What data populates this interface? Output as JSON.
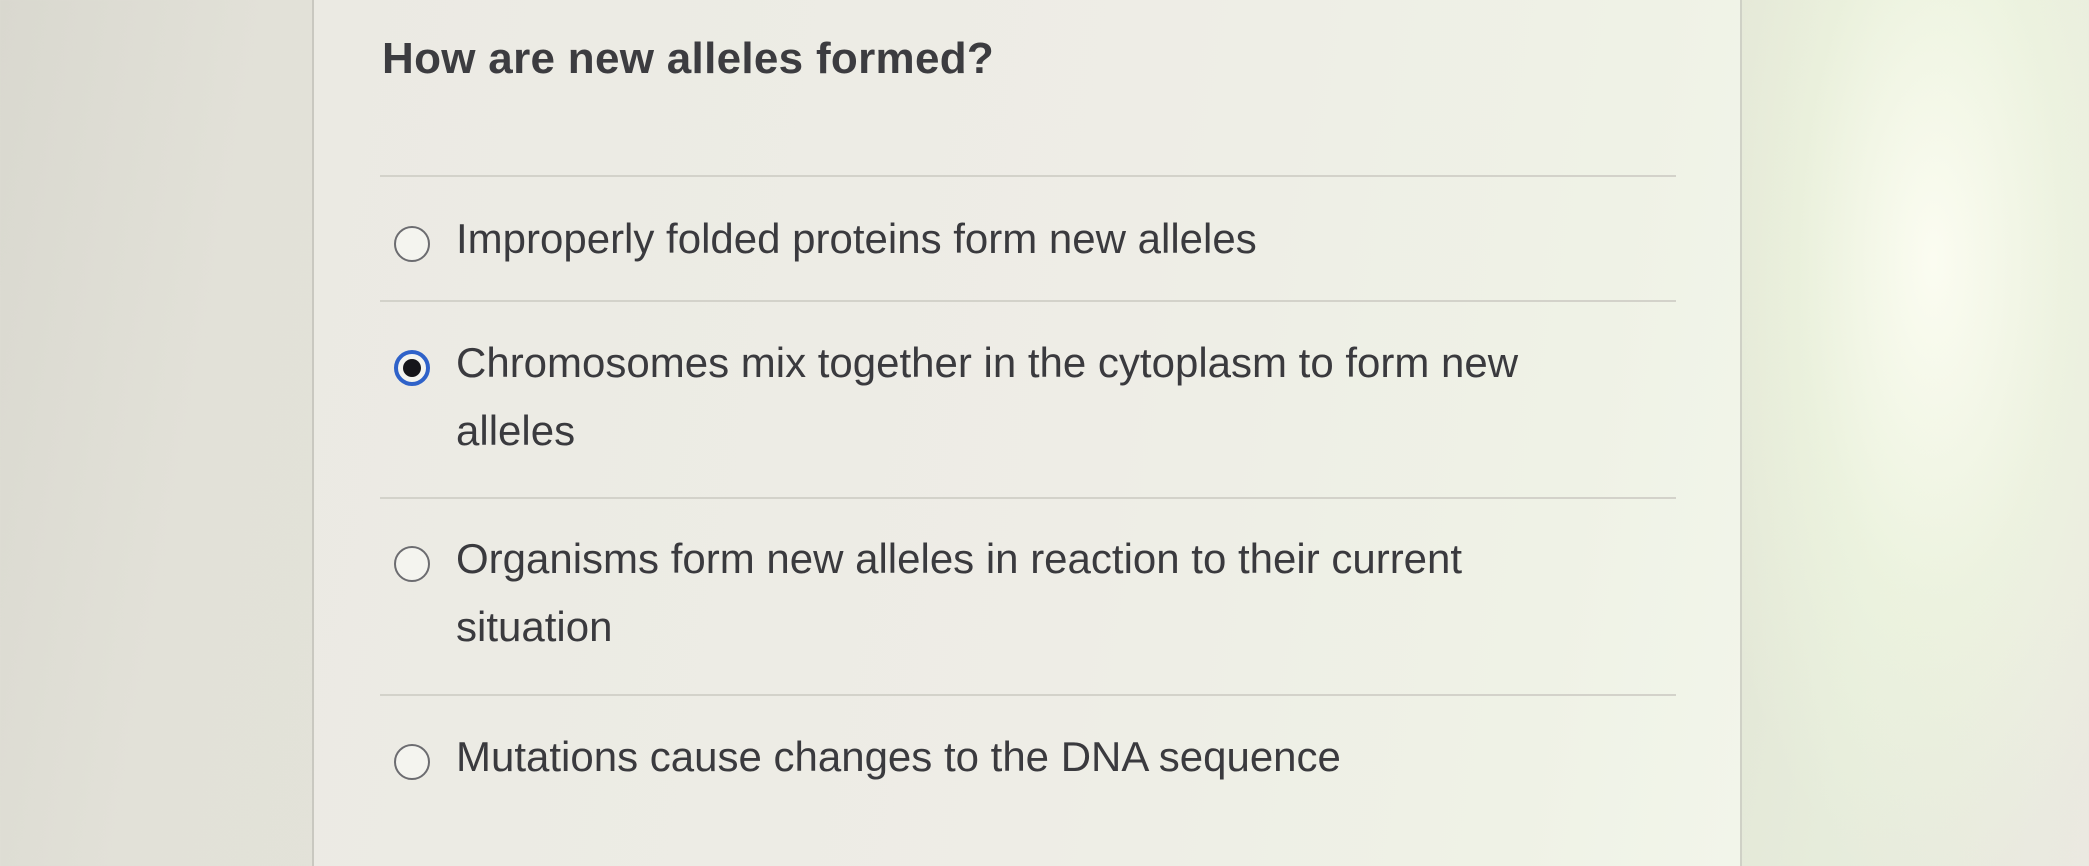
{
  "quiz": {
    "question": "How are new alleles formed?",
    "options": [
      {
        "label": "Improperly folded proteins form new alleles",
        "selected": false
      },
      {
        "label": "Chromosomes mix together in the cytoplasm to form new alleles",
        "selected": true
      },
      {
        "label": "Organisms form new alleles in reaction to their current situation",
        "selected": false
      },
      {
        "label": "Mutations cause changes to the DNA sequence",
        "selected": false
      }
    ]
  },
  "colors": {
    "selected_radio_ring": "#2f62c9",
    "text": "#3a3a3e"
  }
}
